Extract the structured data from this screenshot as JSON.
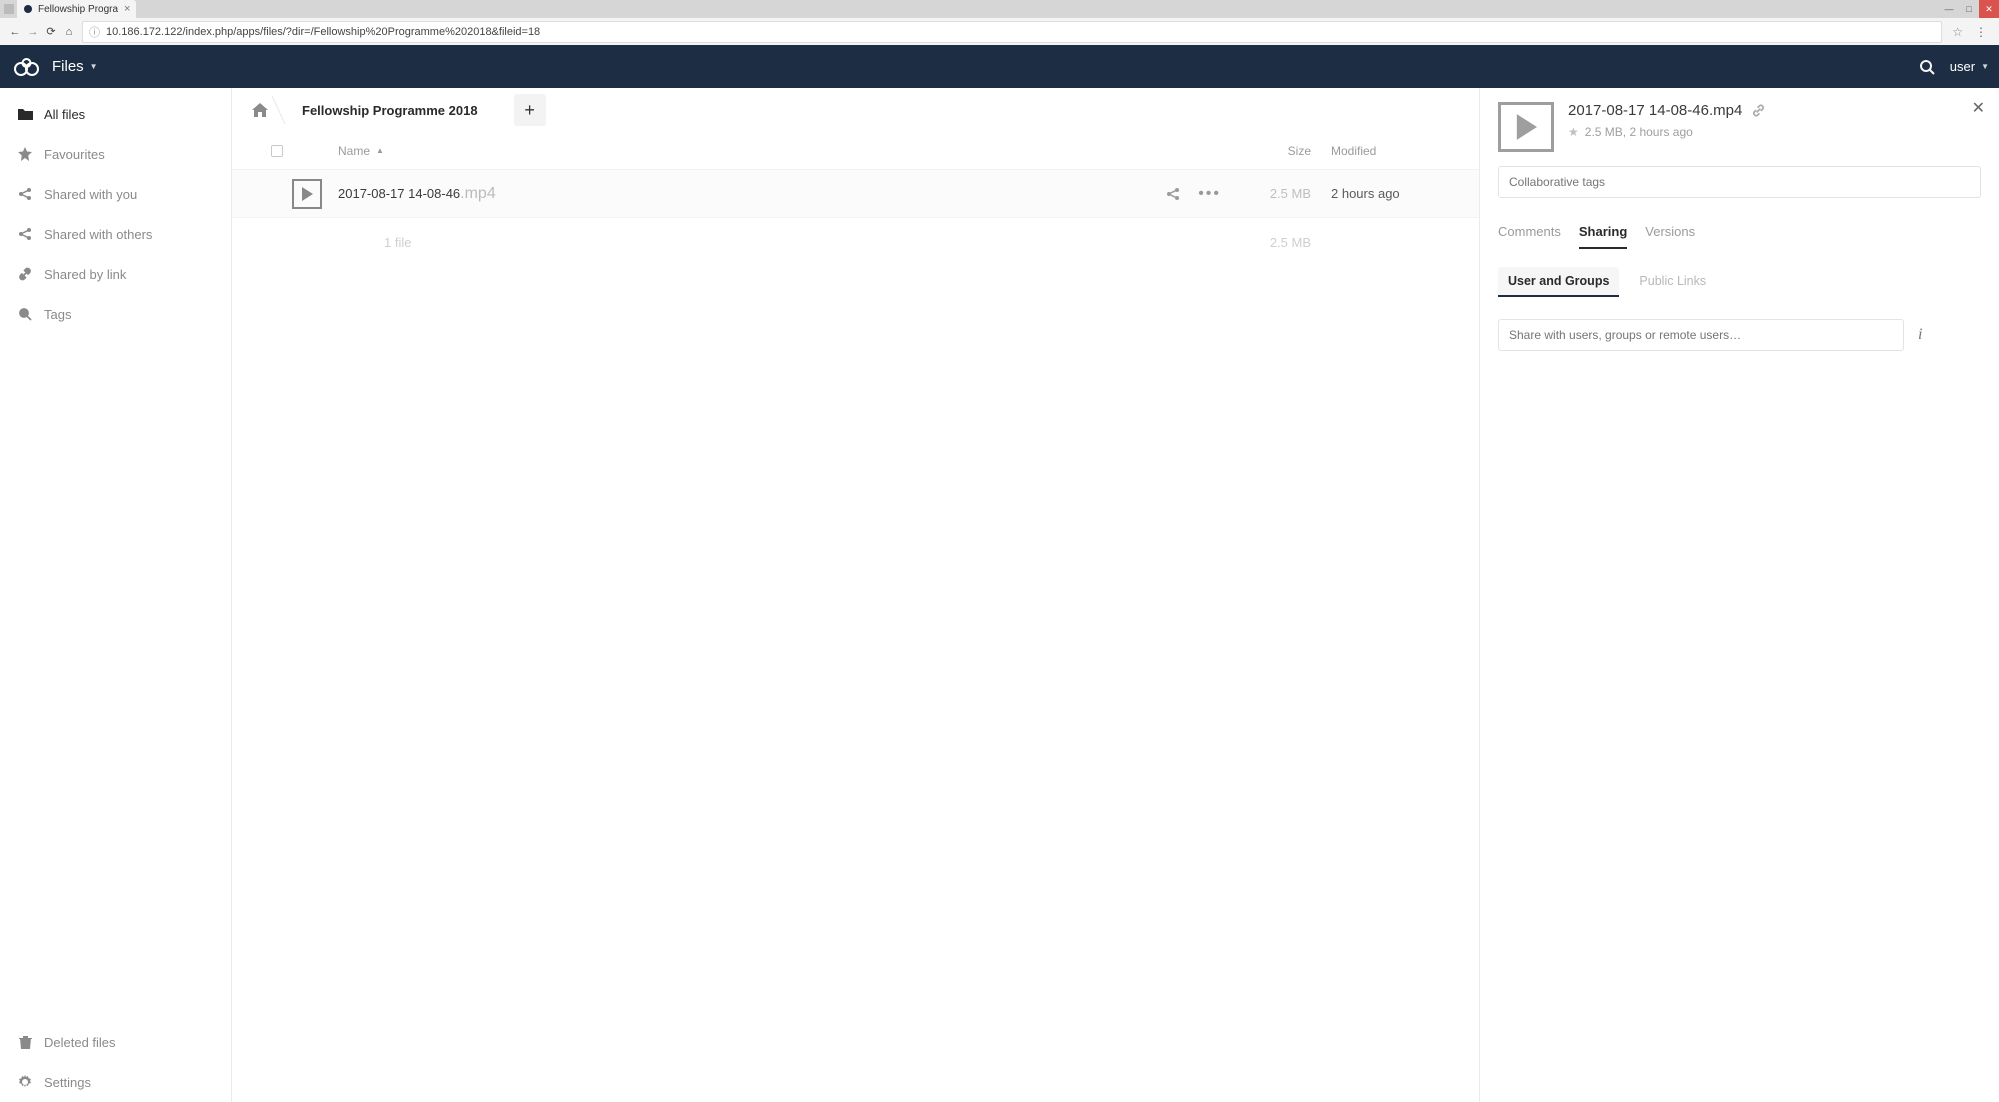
{
  "browser": {
    "tab_title": "Fellowship Progra",
    "url": "10.186.172.122/index.php/apps/files/?dir=/Fellowship%20Programme%202018&fileid=18"
  },
  "header": {
    "app_name": "Files",
    "user_name": "user"
  },
  "sidebar": {
    "items": [
      {
        "icon": "folder",
        "label": "All files",
        "active": true
      },
      {
        "icon": "star",
        "label": "Favourites"
      },
      {
        "icon": "share-in",
        "label": "Shared with you"
      },
      {
        "icon": "share-out",
        "label": "Shared with others"
      },
      {
        "icon": "link",
        "label": "Shared by link"
      },
      {
        "icon": "tag",
        "label": "Tags"
      }
    ],
    "footer": [
      {
        "icon": "trash",
        "label": "Deleted files"
      },
      {
        "icon": "gear",
        "label": "Settings"
      }
    ]
  },
  "breadcrumb": {
    "items": [
      "Fellowship Programme 2018"
    ]
  },
  "table": {
    "columns": {
      "name": "Name",
      "size": "Size",
      "modified": "Modified"
    },
    "rows": [
      {
        "basename": "2017-08-17 14-08-46",
        "ext": ".mp4",
        "size": "2.5 MB",
        "modified": "2 hours ago"
      }
    ],
    "summary": {
      "text": "1 file",
      "size": "2.5 MB"
    }
  },
  "detail": {
    "filename": "2017-08-17 14-08-46.mp4",
    "meta": "2.5 MB, 2 hours ago",
    "tags_placeholder": "Collaborative tags",
    "tabs": [
      {
        "label": "Comments"
      },
      {
        "label": "Sharing",
        "active": true
      },
      {
        "label": "Versions"
      }
    ],
    "subtabs": [
      {
        "label": "User and Groups",
        "active": true
      },
      {
        "label": "Public Links"
      }
    ],
    "share_placeholder": "Share with users, groups or remote users…"
  },
  "colors": {
    "header_bg": "#1d2d44",
    "muted_text": "#9a9a9a",
    "text": "#2a2a2a",
    "border": "#ebebeb"
  }
}
